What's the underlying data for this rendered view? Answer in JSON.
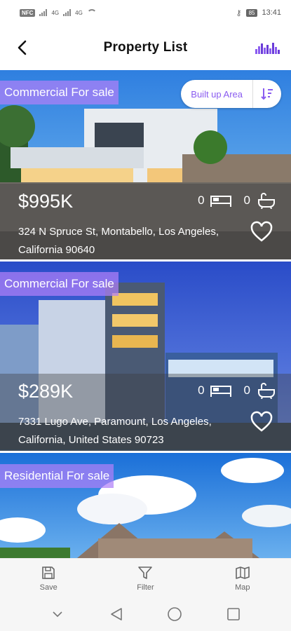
{
  "status_bar": {
    "carrier_badge": "NFC",
    "sim1": "4G",
    "sim2": "4G",
    "battery": "85",
    "time": "13:41"
  },
  "header": {
    "title": "Property List",
    "back_icon": "back-arrow-icon",
    "chart_icon": "bar-chart-icon"
  },
  "sort": {
    "label": "Built up Area",
    "icon": "sort-descending-icon"
  },
  "listings": [
    {
      "tag": "Commercial For sale",
      "price": "$995K",
      "beds": "0",
      "baths": "0",
      "address": "324 N Spruce St, Montabello, Los Angeles, California 90640"
    },
    {
      "tag": "Commercial For sale",
      "price": "$289K",
      "beds": "0",
      "baths": "0",
      "address": "7331 Lugo Ave, Paramount, Los Angeles, California, United States 90723"
    },
    {
      "tag": "Residential For sale"
    }
  ],
  "toolbar": {
    "save": "Save",
    "filter": "Filter",
    "map": "Map"
  },
  "colors": {
    "accent": "#8a5cf0",
    "tag_bg": "#b080f8"
  }
}
